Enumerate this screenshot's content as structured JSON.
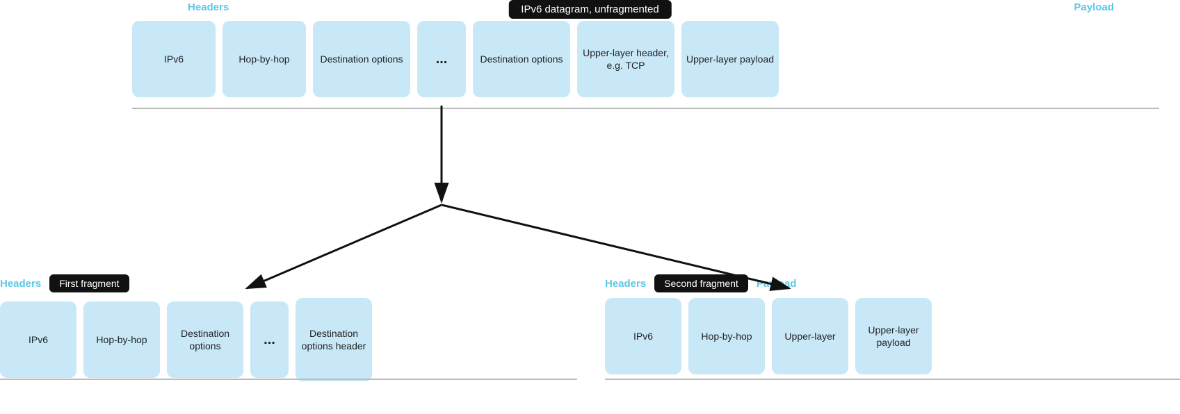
{
  "diagram": {
    "top_title": "IPv6 datagram, unfragmented",
    "top_headers_label": "Headers",
    "top_payload_label": "Payload",
    "top_blocks": [
      {
        "id": "t1",
        "text": "IPv6"
      },
      {
        "id": "t2",
        "text": "Hop-by-hop"
      },
      {
        "id": "t3",
        "text": "Destination options"
      },
      {
        "id": "t4",
        "text": "...",
        "ellipsis": true
      },
      {
        "id": "t5",
        "text": "Destination options"
      },
      {
        "id": "t6",
        "text": "Upper-layer header, e.g. TCP"
      },
      {
        "id": "t7",
        "text": "Upper-layer payload"
      }
    ],
    "first_fragment_label": "First fragment",
    "second_fragment_label": "Second fragment",
    "bottom_left_headers_label": "Headers",
    "bottom_right_headers_label": "Headers",
    "bottom_right_payload_label": "Payload",
    "bottom_left_blocks": [
      {
        "id": "bl1",
        "text": "IPv6"
      },
      {
        "id": "bl2",
        "text": "Hop-by-hop"
      },
      {
        "id": "bl3",
        "text": "Destination options"
      },
      {
        "id": "bl4",
        "text": "...",
        "ellipsis": true
      },
      {
        "id": "bl5",
        "text": "Destination options header",
        "tall": true
      }
    ],
    "bottom_right_blocks": [
      {
        "id": "br1",
        "text": "IPv6"
      },
      {
        "id": "br2",
        "text": "Hop-by-hop"
      },
      {
        "id": "br3",
        "text": "Upper-layer"
      },
      {
        "id": "br4",
        "text": "Upper-layer payload"
      }
    ]
  }
}
